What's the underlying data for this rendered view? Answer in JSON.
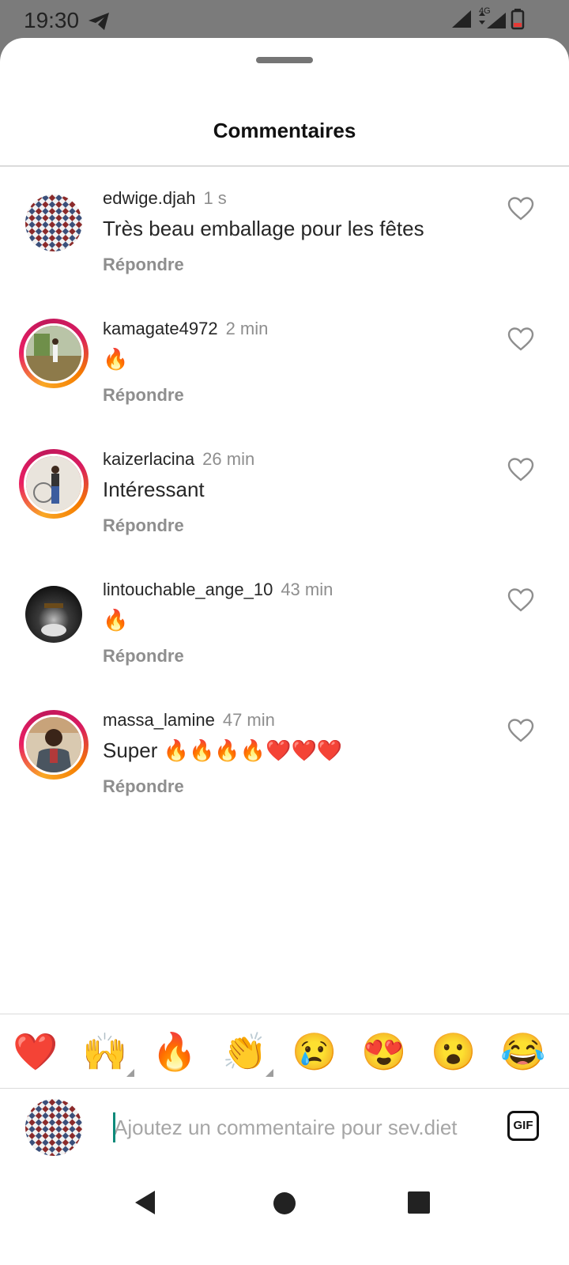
{
  "status_bar": {
    "time": "19:30",
    "telegram_icon": "telegram-icon",
    "network_label": "4G",
    "icons": [
      "signal-icon",
      "signal-4g-icon",
      "battery-low-icon"
    ]
  },
  "sheet": {
    "title": "Commentaires"
  },
  "comments": [
    {
      "username": "edwige.djah",
      "time": "1 s",
      "text": "Très beau emballage pour les fêtes",
      "reply_label": "Répondre",
      "story_ring": false
    },
    {
      "username": "kamagate4972",
      "time": "2 min",
      "text": "🔥",
      "reply_label": "Répondre",
      "story_ring": true
    },
    {
      "username": "kaizerlacina",
      "time": "26 min",
      "text": "Intéressant",
      "reply_label": "Répondre",
      "story_ring": true
    },
    {
      "username": "lintouchable_ange_10",
      "time": "43 min",
      "text": "🔥",
      "reply_label": "Répondre",
      "story_ring": false
    },
    {
      "username": "massa_lamine",
      "time": "47 min",
      "text": "Super 🔥🔥🔥🔥❤️❤️❤️",
      "reply_label": "Répondre",
      "story_ring": true
    }
  ],
  "quick_reactions": [
    "❤️",
    "🙌",
    "🔥",
    "👏",
    "😢",
    "😍",
    "😮",
    "😂"
  ],
  "composer": {
    "placeholder": "Ajoutez un commentaire pour sev.diet",
    "gif_label": "GIF"
  },
  "nav_bar": {
    "icons": [
      "back-icon",
      "home-icon",
      "recents-icon"
    ]
  },
  "colors": {
    "background": "#ffffff",
    "secondary_text": "#8e8e8e",
    "divider": "#dbdbdb",
    "story_ring_start": "#f9a825",
    "story_ring_end": "#e91e63",
    "caret": "#0d8a7a"
  }
}
